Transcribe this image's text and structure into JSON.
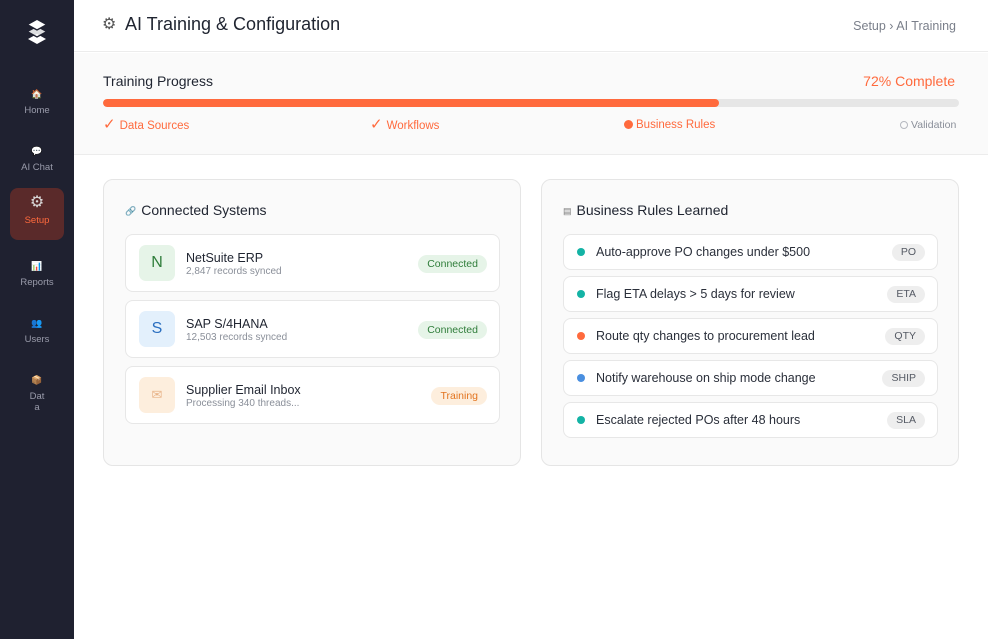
{
  "sidebar": {
    "items": [
      {
        "key": "home",
        "icon": "home-icon",
        "glyph": "🏠",
        "label": "Home",
        "active": false
      },
      {
        "key": "ai-chat",
        "icon": "chat-bubble-icon",
        "glyph": "💬",
        "label": "AI Chat",
        "active": false
      },
      {
        "key": "setup",
        "icon": "gear-icon",
        "glyph": "⚙",
        "label": "Setup",
        "active": true
      },
      {
        "key": "reports",
        "icon": "bar-chart-icon",
        "glyph": "📊",
        "label": "Reports",
        "active": false
      },
      {
        "key": "users",
        "icon": "users-icon",
        "glyph": "👥",
        "label": "Users",
        "active": false
      },
      {
        "key": "data",
        "icon": "box-icon",
        "glyph": "📦",
        "label": "Dat\na",
        "active": false
      }
    ]
  },
  "header": {
    "title_icon": "⚙",
    "title": "AI Training & Configuration",
    "breadcrumb": "Setup › AI Training"
  },
  "progress": {
    "label": "Training Progress",
    "percent_text": "72% Complete",
    "percent": 72,
    "steps": [
      {
        "label": "Data Sources",
        "status": "done"
      },
      {
        "label": "Workflows",
        "status": "done"
      },
      {
        "label": "Business Rules",
        "status": "current"
      },
      {
        "label": "Validation",
        "status": "pending"
      }
    ]
  },
  "connected_systems": {
    "icon": "🔗",
    "title": "Connected Systems",
    "items": [
      {
        "avatar": "N",
        "name": "NetSuite ERP",
        "meta": "2,847 records synced",
        "status": "Connected"
      },
      {
        "avatar": "S",
        "name": "SAP S/4HANA",
        "meta": "12,503 records synced",
        "status": "Connected"
      },
      {
        "avatar": "✉",
        "name": "Supplier Email Inbox",
        "meta": "Processing 340 threads...",
        "status": "Training"
      }
    ]
  },
  "business_rules": {
    "icon": "▤",
    "title": "Business Rules Learned",
    "items": [
      {
        "text": "Auto-approve PO changes under $500",
        "tag": "PO",
        "dot_color": "#14b3a5"
      },
      {
        "text": "Flag ETA delays > 5 days for review",
        "tag": "ETA",
        "dot_color": "#14b3a5"
      },
      {
        "text": "Route qty changes to procurement lead",
        "tag": "QTY",
        "dot_color": "#ff6a3d"
      },
      {
        "text": "Notify warehouse on ship mode change",
        "tag": "SHIP",
        "dot_color": "#4a8fe0"
      },
      {
        "text": "Escalate rejected POs after 48 hours",
        "tag": "SLA",
        "dot_color": "#14b3a5"
      }
    ]
  },
  "colors": {
    "accent": "#ff6a3d",
    "sidebar_bg": "#1f2130",
    "connected_bg": "#e6f4e8",
    "connected_fg": "#2f7d3a",
    "training_bg": "#fdeedd",
    "training_fg": "#e2741f"
  }
}
